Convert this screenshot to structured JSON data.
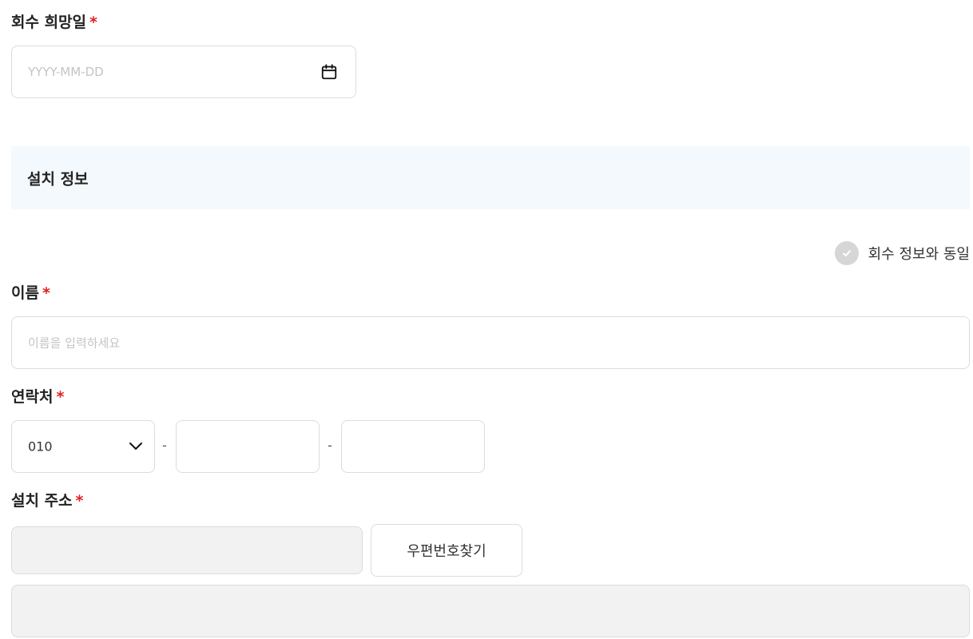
{
  "pickup": {
    "date_label": "회수 희망일",
    "required_mark": "*",
    "date_placeholder": "YYYY-MM-DD"
  },
  "install_section": {
    "title": "설치 정보",
    "same_as_pickup_label": "회수 정보와 동일",
    "same_as_pickup_checked": false,
    "name_label": "이름",
    "name_placeholder": "이름을 입력하세요",
    "contact_label": "연락처",
    "phone_prefix_selected": "010",
    "phone_separator": "-",
    "address_label": "설치 주소",
    "zip_button_label": "우편번호찾기"
  },
  "colors": {
    "required": "#e02020",
    "section_bg": "#f4f9fd",
    "disabled_bg": "#f2f2f2",
    "border": "#dcdcdc",
    "check_inactive": "#d6d6d6"
  },
  "icons": {
    "calendar": "calendar-icon",
    "check": "check-icon",
    "chevron": "chevron-down-icon"
  }
}
